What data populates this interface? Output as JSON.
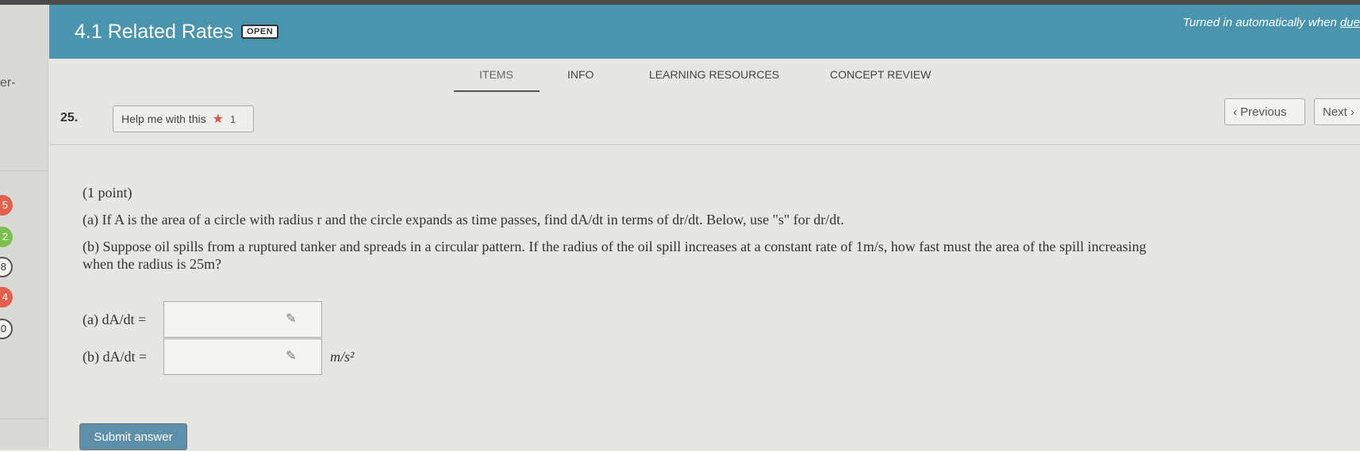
{
  "header": {
    "title": "4.1 Related Rates",
    "badge": "OPEN",
    "turned_in_text": "Turned in automatically when ",
    "turned_in_link": "due"
  },
  "sidebar": {
    "partial_text": "er-",
    "question_markers": [
      "5",
      "2",
      "8",
      "4",
      "0"
    ]
  },
  "tabs": [
    {
      "label": "ITEMS",
      "active": true
    },
    {
      "label": "INFO",
      "active": false
    },
    {
      "label": "LEARNING RESOURCES",
      "active": false
    },
    {
      "label": "CONCEPT REVIEW",
      "active": false
    }
  ],
  "question": {
    "number": "25.",
    "help_label": "Help me with this",
    "help_count": "1",
    "previous_label": "Previous",
    "next_label": "Next",
    "points": "(1 point)",
    "part_a_text": "(a) If A is the area of a circle with radius r and the circle expands as time passes, find dA/dt in terms of dr/dt. Below, use \"s\" for dr/dt.",
    "part_b_line1": "(b) Suppose oil spills from a ruptured tanker and spreads in a circular pattern. If the radius of the oil spill increases at a constant rate of 1m/s, how fast must the area of the spill increasing",
    "part_b_line2": "when the radius is 25m?",
    "answer_a_label": "(a) dA/dt =",
    "answer_a_value": "",
    "answer_b_label": "(b) dA/dt =",
    "answer_b_value": "",
    "answer_b_unit": "m/s²",
    "submit_label": "Submit answer"
  },
  "colors": {
    "header_bg": "#4a94ad",
    "submit_bg": "#5e8fa8",
    "star": "#d9534f",
    "marker_red": "#e2614d",
    "marker_green": "#7cbf4f"
  }
}
